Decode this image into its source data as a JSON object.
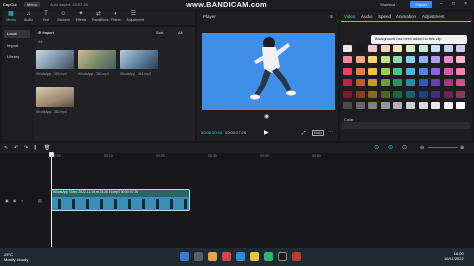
{
  "titlebar": {
    "app_name": "CapCut",
    "menu_label": "Menu",
    "project_name": "Auto saved: 16:57:25",
    "watermark": "www.BANDICAM.com",
    "shortcut_label": "Shortcut",
    "export_label": "Export"
  },
  "toolbar": {
    "tools": [
      {
        "label": "Media",
        "icon": "media-icon"
      },
      {
        "label": "Audio",
        "icon": "audio-icon"
      },
      {
        "label": "Text",
        "icon": "text-icon"
      },
      {
        "label": "Stickers",
        "icon": "sticker-icon"
      },
      {
        "label": "Effects",
        "icon": "effects-icon"
      },
      {
        "label": "Transitions",
        "icon": "transition-icon"
      },
      {
        "label": "Filters",
        "icon": "filter-icon"
      },
      {
        "label": "Adjustment",
        "icon": "adjust-icon"
      }
    ]
  },
  "sidebar": {
    "items": [
      {
        "label": "Local"
      },
      {
        "label": "Import"
      },
      {
        "label": "Library"
      }
    ]
  },
  "media": {
    "import_label": "Import",
    "all_label": "All",
    "sort_label": "Sort",
    "filter_label": "All",
    "thumbs": [
      {
        "caption": "WhatsApp...359.mp4"
      },
      {
        "caption": "WhatsApp...360.mp4"
      },
      {
        "caption": "WhatsApp...361.mp4"
      },
      {
        "caption": "WhatsApp...362.mp4"
      }
    ]
  },
  "player": {
    "title": "Player",
    "timecode_current": "00:00:00:00",
    "timecode_total": "00:00:07:26",
    "ratio_label": "Ratio"
  },
  "inspector": {
    "tabs": [
      "Video",
      "Audio",
      "Speed",
      "Animation",
      "Adjustment"
    ],
    "tooltip": "Background has been added to this clip",
    "color_label": "Color",
    "colors": [
      "#e6e6e6",
      "#1a1a1a",
      "#f3c9cf",
      "#f3d2bd",
      "#f5e4b8",
      "#d9eebd",
      "#c2ecd8",
      "#bfe6ef",
      "#c3d4f4",
      "#d7c8f1",
      "#f28a9e",
      "#f5a683",
      "#f6d27a",
      "#bfe08c",
      "#8edcb4",
      "#86d4e6",
      "#8fb1f0",
      "#b79af0",
      "#e88cc7",
      "#f4b6d2",
      "#e8405f",
      "#ee7a45",
      "#f2c13d",
      "#9ccd53",
      "#43c88a",
      "#40bcd8",
      "#4f86e8",
      "#8e64e6",
      "#d957a8",
      "#f084b5",
      "#b8283f",
      "#c45a2a",
      "#c89a22",
      "#6f9c33",
      "#2a935f",
      "#2a8aa2",
      "#2f5cb6",
      "#6344b0",
      "#a6367d",
      "#c85587",
      "#7d1a2b",
      "#8a3c1b",
      "#8c6b16",
      "#4a6a23",
      "#1c6642",
      "#1d5f70",
      "#203f7c",
      "#432e78",
      "#6f2454",
      "#8a3a5d",
      "#4d4d4d",
      "#666666",
      "#808080",
      "#999999",
      "#b3b3b3",
      "#cccccc",
      "#d9d9d9",
      "#e6e6e6",
      "#f2f2f2",
      "#ffffff"
    ]
  },
  "timeline": {
    "ruler": [
      "00:00",
      "00:10",
      "00:20",
      "00:30",
      "00:40",
      "00:50"
    ],
    "clip_title": "WhatsApp Video 2022-11-16 at 15.26.19.mp4   00:00:07:26"
  },
  "taskbar": {
    "weather_temp": "25°C",
    "weather_desc": "Mostly cloudy",
    "time": "16:00",
    "date": "16/11/2022"
  }
}
